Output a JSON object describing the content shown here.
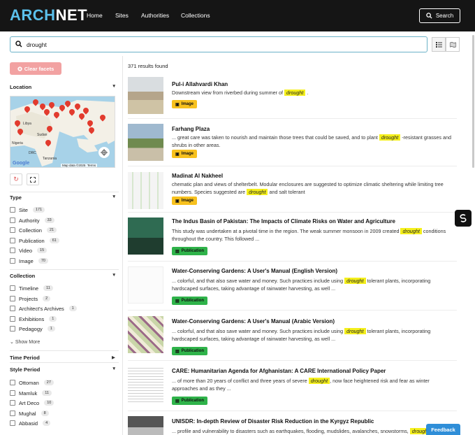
{
  "header": {
    "logo_part1": "ARCH",
    "logo_part2": "NET",
    "nav": [
      "Home",
      "Sites",
      "Authorities",
      "Collections"
    ],
    "search_button": "Search"
  },
  "search": {
    "value": "drought"
  },
  "sidebar": {
    "clear_facets": "Clear facets",
    "location_heading": "Location",
    "map_labels": {
      "libya": "Libya",
      "sudan": "Sudan",
      "nigeria": "Nigeria",
      "drc": "DRC",
      "tanzania": "Tanzania",
      "google": "Google",
      "map_data": "Map data ©2025",
      "terms": "Terms"
    },
    "type_heading": "Type",
    "types": [
      {
        "label": "Site",
        "count": "171"
      },
      {
        "label": "Authority",
        "count": "33"
      },
      {
        "label": "Collection",
        "count": "21"
      },
      {
        "label": "Publication",
        "count": "61"
      },
      {
        "label": "Video",
        "count": "15"
      },
      {
        "label": "Image",
        "count": "70"
      }
    ],
    "collection_heading": "Collection",
    "collections": [
      {
        "label": "Timeline",
        "count": "11"
      },
      {
        "label": "Projects",
        "count": "2"
      },
      {
        "label": "Architect's Archives",
        "count": "1"
      },
      {
        "label": "Exhibitions",
        "count": "1"
      },
      {
        "label": "Pedagogy",
        "count": "1"
      }
    ],
    "show_more": "Show More",
    "time_period_heading": "Time Period",
    "style_period_heading": "Style Period",
    "styles": [
      {
        "label": "Ottoman",
        "count": "27"
      },
      {
        "label": "Mamluk",
        "count": "11"
      },
      {
        "label": "Art Deco",
        "count": "10"
      },
      {
        "label": "Mughal",
        "count": "8"
      },
      {
        "label": "Abbasid",
        "count": "4"
      }
    ]
  },
  "results": {
    "count_text": "371 results found",
    "items": [
      {
        "title": "Pul-i Allahvardi Khan",
        "pre": "Downstream view from riverbed during summer of ",
        "hl": "drought",
        "post": " .",
        "pre2": "",
        "tag": "Image"
      },
      {
        "title": "Farhang Plaza",
        "pre": "... great care was taken to nourish and maintain those trees that could be saved, and to plant ",
        "hl": "drought",
        "post": " -resistant grasses and shrubs in other areas.",
        "tag": "Image"
      },
      {
        "title": "Madinat Al Nakheel",
        "pre": "chematic plan and views of shelterbelt. Modular enclosures are suggested to optimize climatic sheltering while limiting tree numbers. Species suggested are ",
        "hl": "drought",
        "post": " and salt tolerant",
        "tag": "Image"
      },
      {
        "title": "The Indus Basin of Pakistan: The Impacts of Climate Risks on Water and Agriculture",
        "pre": "This study was undertaken at a pivotal time in the region. The weak summer monsoon in 2009 created ",
        "hl": "drought",
        "post": " conditions throughout the country. This followed ...",
        "tag": "Publication"
      },
      {
        "title": "Water-Conserving Gardens: A User's Manual (English Version)",
        "pre": "... colorful, and that also save water and money.  Such practices include using ",
        "hl": "drought",
        "post": " tolerant plants, incorporating hardscaped surfaces, taking advantage of rainwater harvesting, as well ...",
        "tag": "Publication"
      },
      {
        "title": "Water-Conserving Gardens: A User's Manual (Arabic Version)",
        "pre": "... colorful, and that also save water and money.  Such practices include using ",
        "hl": "drought",
        "post": " tolerant plants, incorporating hardscaped surfaces, taking advantage of rainwater harvesting, as well ...",
        "tag": "Publication"
      },
      {
        "title": "CARE: Humanitarian Agenda for Afghanistan: A CARE International Policy Paper",
        "pre": "... of more than 20 years of conflict and three years of severe ",
        "hl": "drought",
        "post": ", now face heightened risk and fear as winter approaches and as they ...",
        "tag": "Publication"
      },
      {
        "title": "UNISDR: In-depth Review of Disaster Risk Reduction in the Kyrgyz Republic",
        "pre": "... profile and vulnerability to disasters such as earthquakes, flooding, mudslides, avalanches, snowstorms, ",
        "hl": "drought",
        "post": "",
        "tag": ""
      }
    ]
  },
  "feedback": "Feedback",
  "colors": {
    "nav_bg": "#151515",
    "accent": "#5bc0eb",
    "image_tag": "#f7c11e",
    "publication_tag": "#2fb34a",
    "highlight": "#f4ef1c",
    "clear_facets": "#f2a2a2"
  }
}
